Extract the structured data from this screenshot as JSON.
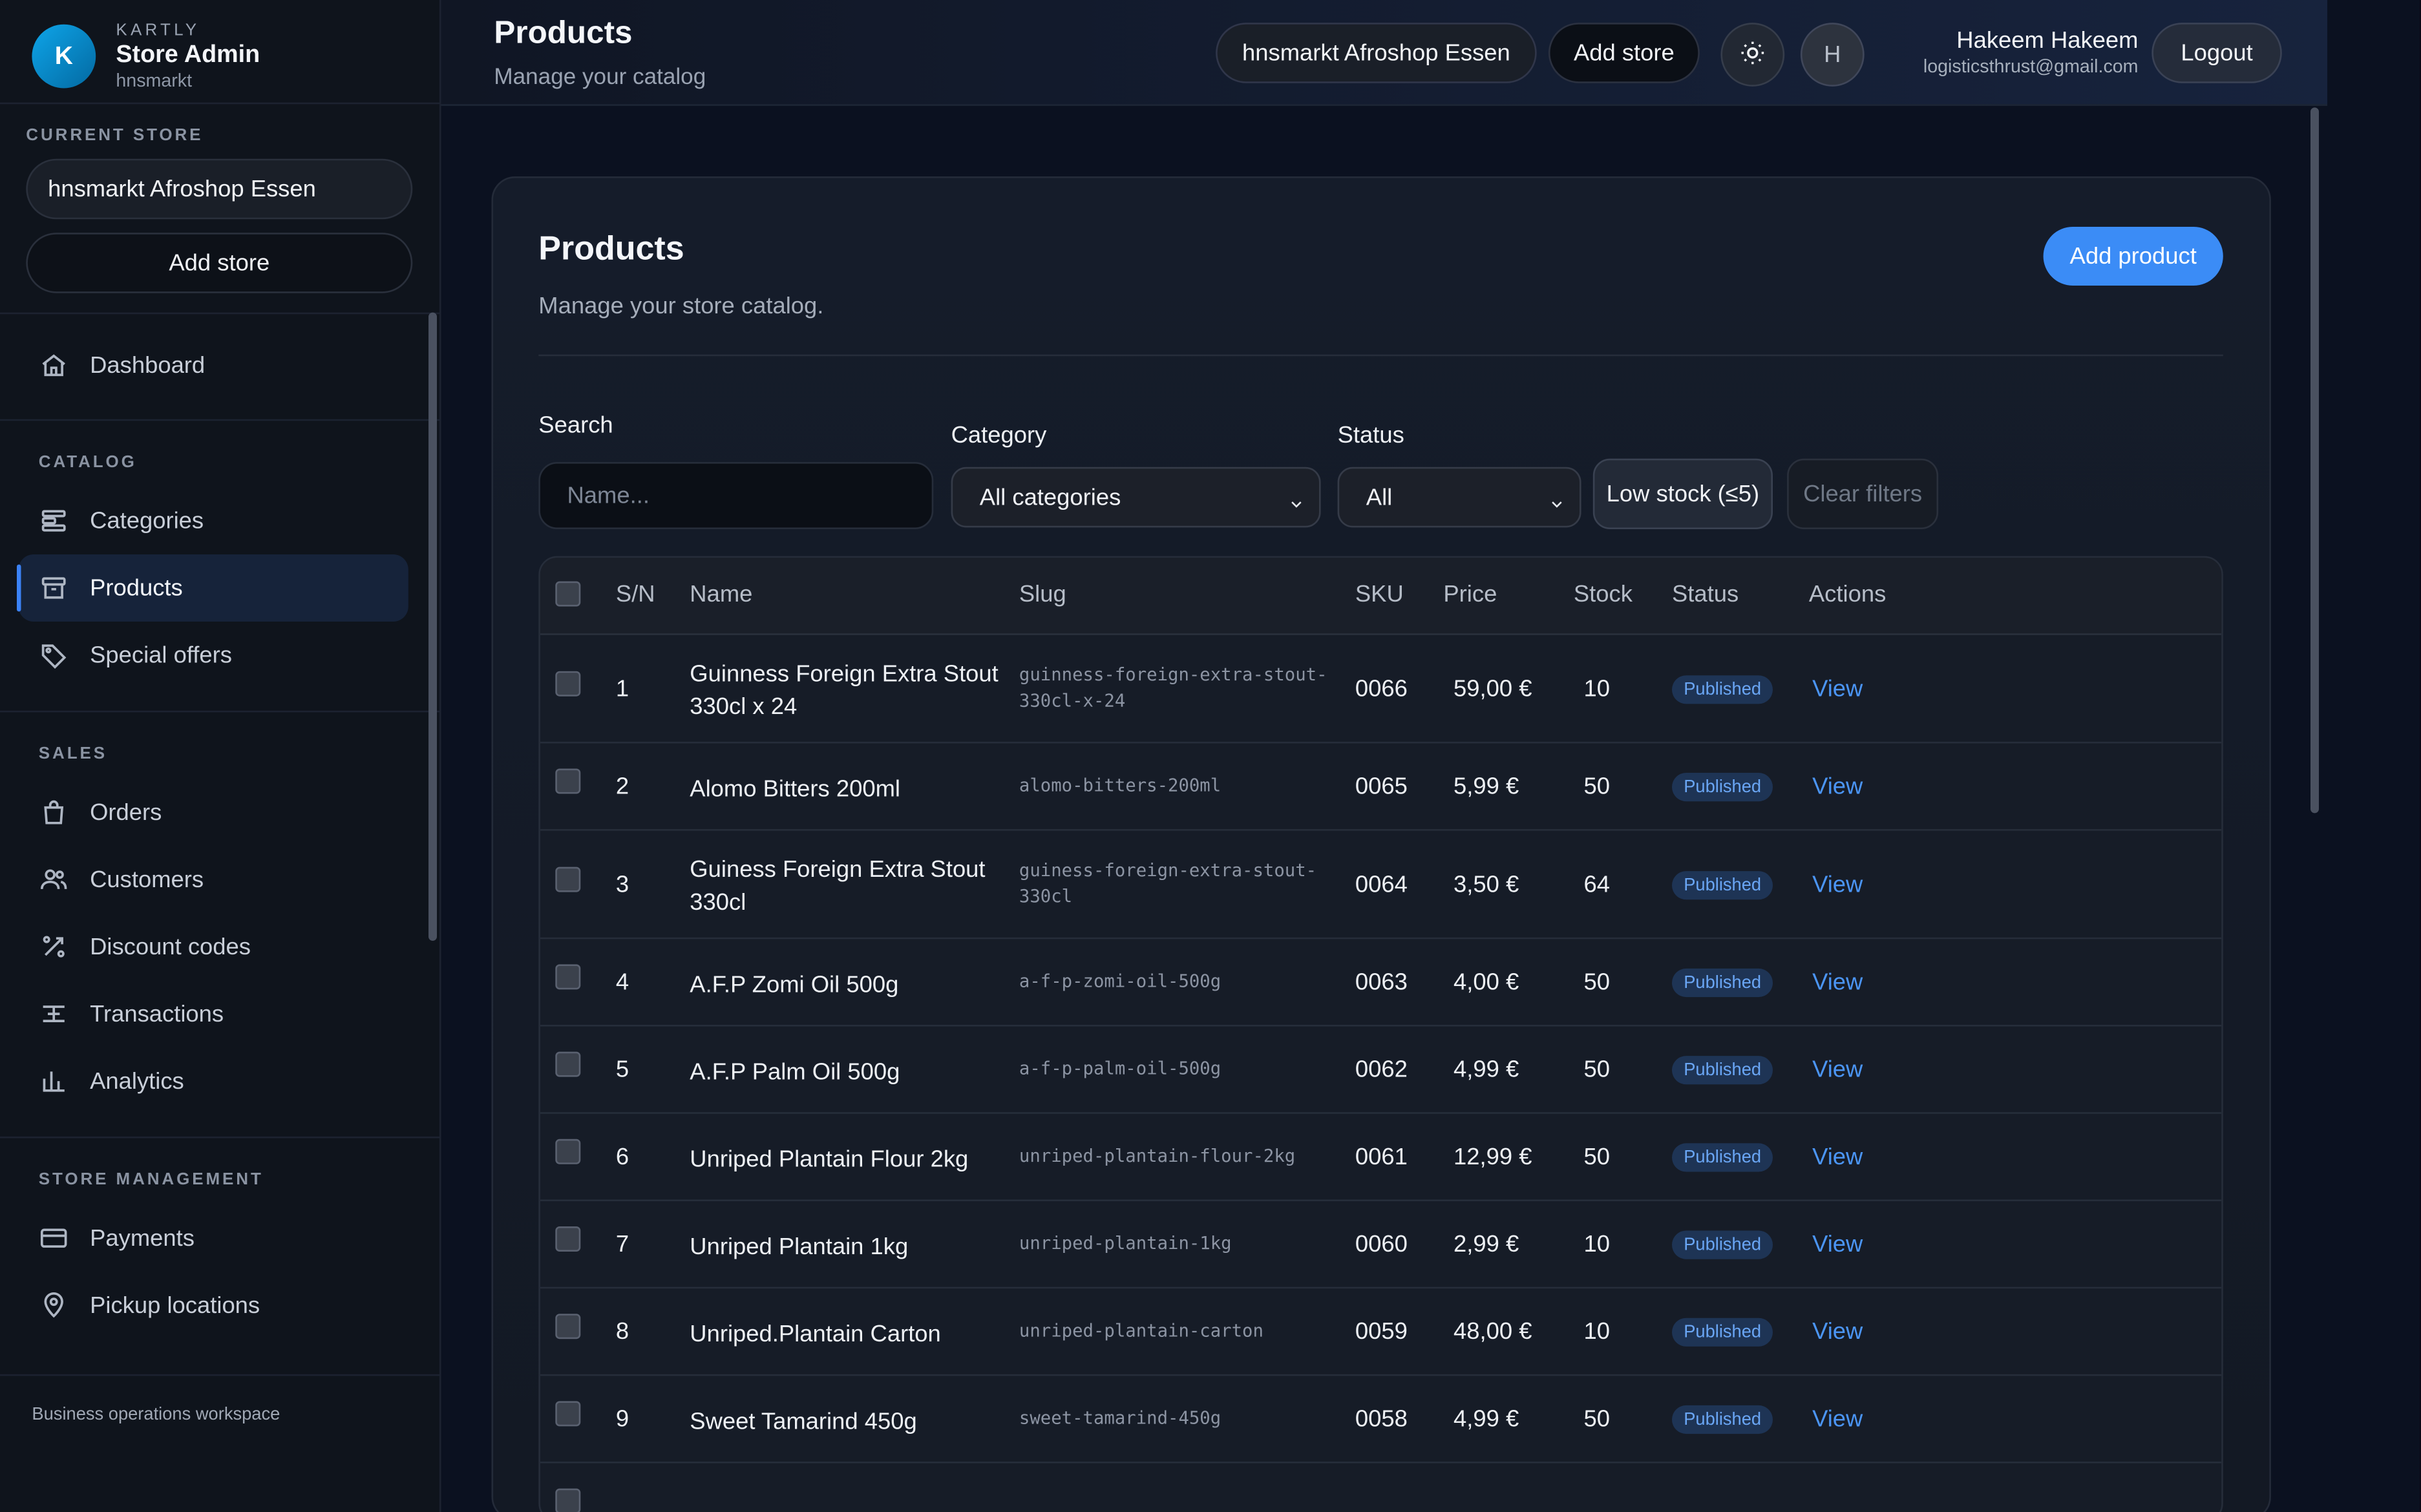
{
  "sidebar": {
    "brand_avatar": "K",
    "brand_kicker": "KARTLY",
    "brand_title": "Store Admin",
    "brand_sub": "hnsmarkt",
    "current_store_label": "CURRENT STORE",
    "current_store": "hnsmarkt Afroshop Essen",
    "add_store": "Add store",
    "dashboard": "Dashboard",
    "sections": {
      "catalog": "CATALOG",
      "sales": "SALES",
      "store_management": "STORE MANAGEMENT"
    },
    "catalog_items": [
      {
        "label": "Categories",
        "icon": "categories-icon"
      },
      {
        "label": "Products",
        "icon": "box-icon",
        "active": true
      },
      {
        "label": "Special offers",
        "icon": "tag-icon"
      }
    ],
    "sales_items": [
      {
        "label": "Orders",
        "icon": "bag-icon"
      },
      {
        "label": "Customers",
        "icon": "users-icon"
      },
      {
        "label": "Discount codes",
        "icon": "discount-icon"
      },
      {
        "label": "Transactions",
        "icon": "transactions-icon"
      },
      {
        "label": "Analytics",
        "icon": "chart-icon"
      }
    ],
    "store_items": [
      {
        "label": "Payments",
        "icon": "card-icon"
      },
      {
        "label": "Pickup locations",
        "icon": "pin-icon"
      }
    ],
    "footer": "Business operations workspace"
  },
  "header": {
    "title": "Products",
    "subtitle": "Manage your catalog",
    "store": "hnsmarkt Afroshop Essen",
    "add_store": "Add store",
    "avatar": "H",
    "user_name": "Hakeem Hakeem",
    "user_email": "logisticsthrust@gmail.com",
    "logout": "Logout"
  },
  "card": {
    "title": "Products",
    "subtitle": "Manage your store catalog.",
    "add_product": "Add product"
  },
  "filters": {
    "search_label": "Search",
    "search_placeholder": "Name...",
    "category_label": "Category",
    "category_value": "All categories",
    "status_label": "Status",
    "status_value": "All",
    "low_stock": "Low stock (≤5)",
    "clear": "Clear filters"
  },
  "table": {
    "columns": [
      "S/N",
      "Name",
      "Slug",
      "SKU",
      "Price",
      "Stock",
      "Status",
      "Actions"
    ],
    "rows": [
      {
        "sn": "1",
        "name": [
          "Guinness Foreign Extra Stout",
          "330cl x 24"
        ],
        "slug": [
          "guinness-foreign-extra-stout-",
          "330cl-x-24"
        ],
        "sku": "0066",
        "price": "59,00 €",
        "stock": "10",
        "status": "Published",
        "action": "View"
      },
      {
        "sn": "2",
        "name": [
          "Alomo Bitters 200ml"
        ],
        "slug": [
          "alomo-bitters-200ml"
        ],
        "sku": "0065",
        "price": "5,99 €",
        "stock": "50",
        "status": "Published",
        "action": "View"
      },
      {
        "sn": "3",
        "name": [
          "Guiness Foreign Extra Stout",
          "330cl"
        ],
        "slug": [
          "guiness-foreign-extra-stout-",
          "330cl"
        ],
        "sku": "0064",
        "price": "3,50 €",
        "stock": "64",
        "status": "Published",
        "action": "View"
      },
      {
        "sn": "4",
        "name": [
          "A.F.P Zomi Oil 500g"
        ],
        "slug": [
          "a-f-p-zomi-oil-500g"
        ],
        "sku": "0063",
        "price": "4,00 €",
        "stock": "50",
        "status": "Published",
        "action": "View"
      },
      {
        "sn": "5",
        "name": [
          "A.F.P Palm Oil 500g"
        ],
        "slug": [
          "a-f-p-palm-oil-500g"
        ],
        "sku": "0062",
        "price": "4,99 €",
        "stock": "50",
        "status": "Published",
        "action": "View"
      },
      {
        "sn": "6",
        "name": [
          "Unriped Plantain Flour 2kg"
        ],
        "slug": [
          "unriped-plantain-flour-2kg"
        ],
        "sku": "0061",
        "price": "12,99 €",
        "stock": "50",
        "status": "Published",
        "action": "View"
      },
      {
        "sn": "7",
        "name": [
          "Unriped Plantain 1kg"
        ],
        "slug": [
          "unriped-plantain-1kg"
        ],
        "sku": "0060",
        "price": "2,99 €",
        "stock": "10",
        "status": "Published",
        "action": "View"
      },
      {
        "sn": "8",
        "name": [
          "Unriped.Plantain Carton"
        ],
        "slug": [
          "unriped-plantain-carton"
        ],
        "sku": "0059",
        "price": "48,00 €",
        "stock": "10",
        "status": "Published",
        "action": "View"
      },
      {
        "sn": "9",
        "name": [
          "Sweet Tamarind 450g"
        ],
        "slug": [
          "sweet-tamarind-450g"
        ],
        "sku": "0058",
        "price": "4,99 €",
        "stock": "50",
        "status": "Published",
        "action": "View"
      }
    ]
  }
}
